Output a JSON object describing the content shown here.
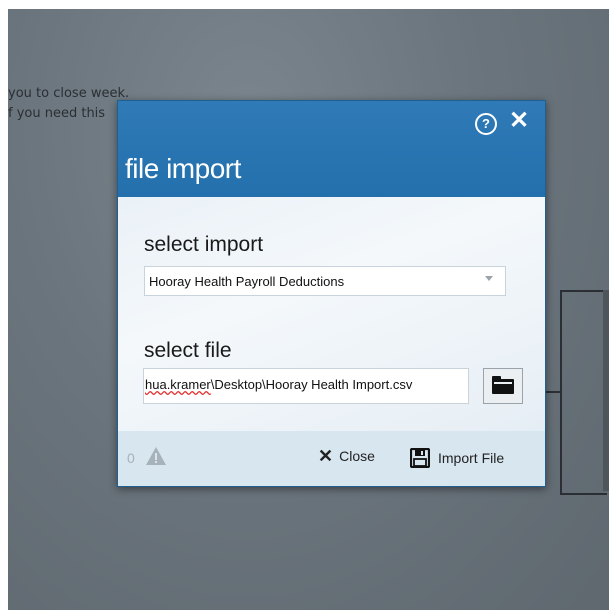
{
  "background": {
    "lines": [
      "you to close week.",
      "f you need this"
    ]
  },
  "dialog": {
    "title": "file import",
    "help_icon": "help-circle-icon",
    "close_icon": "close-icon",
    "select_import": {
      "label": "select import",
      "value": "Hooray Health Payroll Deductions"
    },
    "select_file": {
      "label": "select file",
      "path_user": "hua.kramer",
      "path_rest": "\\Desktop\\Hooray Health Import.csv",
      "browse_icon": "folder-icon"
    },
    "footer": {
      "warning_count": "0",
      "warning_icon": "warning-triangle-icon",
      "close_label": "Close",
      "import_label": "Import File",
      "import_icon": "floppy-disk-icon"
    }
  },
  "colors": {
    "header": "#2370ad",
    "footer": "#d8e6f0",
    "overlay": "#6b757d"
  }
}
